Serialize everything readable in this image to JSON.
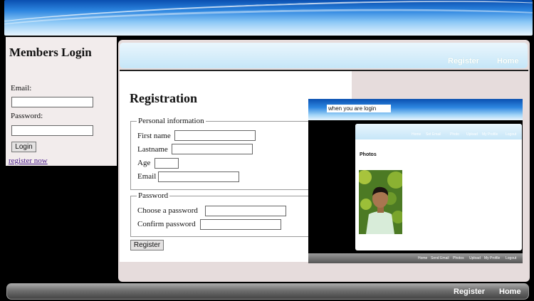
{
  "login": {
    "title": "Members Login",
    "email_label": "Email:",
    "password_label": "Password:",
    "login_button": "Login",
    "register_link": "register now"
  },
  "nav": {
    "register": "Register",
    "home": "Home"
  },
  "registration": {
    "title": "Registration",
    "personal_legend": "Personal information",
    "first_name_label": "First name",
    "lastname_label": "Lastname",
    "age_label": "Age",
    "email_label": "Email",
    "password_legend": "Password",
    "choose_password_label": "Choose a password",
    "confirm_password_label": "Confirm password",
    "register_button": "Register"
  },
  "inset": {
    "banner_text": "when you are login",
    "top_nav": [
      "Home",
      "Set Email",
      "Photo",
      "Upload",
      "My Profile",
      "Logout"
    ],
    "section_title": "Photos",
    "bottom_nav": [
      "Home",
      "Send Email",
      "Photos",
      "Upload",
      "My Profile",
      "Logout"
    ]
  },
  "footer": {
    "register": "Register",
    "home": "Home"
  }
}
